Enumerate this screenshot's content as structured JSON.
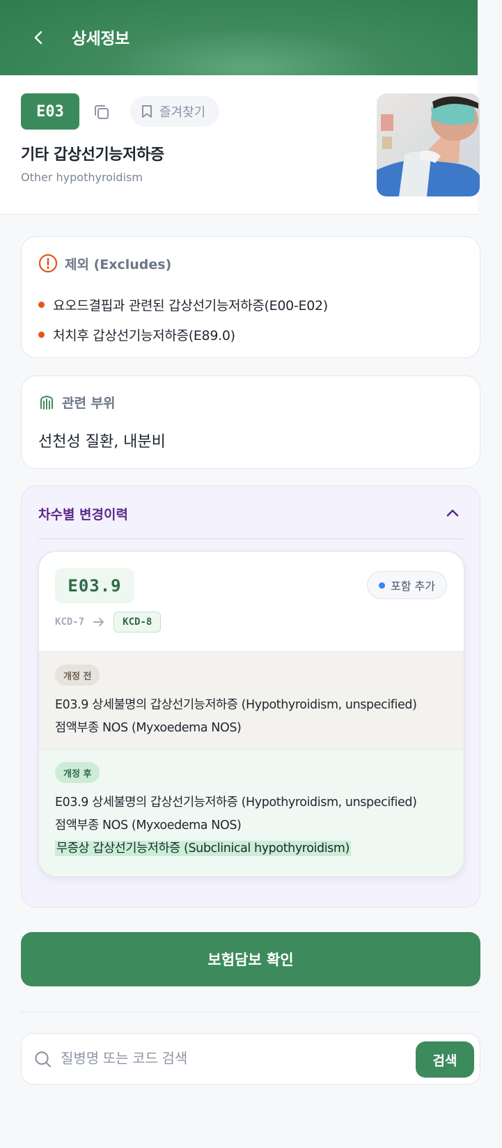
{
  "header": {
    "title": "상세정보",
    "back_icon": "chevron-left-icon"
  },
  "disease": {
    "code": "E03",
    "bookmark_label": "즐겨찾기",
    "name_ko": "기타 갑상선기능저하증",
    "name_en": "Other hypothyroidism"
  },
  "excludes": {
    "title": "제외 (Excludes)",
    "items": [
      "요오드결핍과 관련된 갑상선기능저하증(E00-E02)",
      "처치후 갑상선기능저하증(E89.0)"
    ]
  },
  "region": {
    "title": "관련 부위",
    "value": "선천성 질환, 내분비"
  },
  "history": {
    "title": "차수별 변경이력",
    "entry": {
      "code": "E03.9",
      "change_type": "포함 추가",
      "from_version": "KCD-7",
      "to_version": "KCD-8",
      "before": {
        "tag": "개정 전",
        "lines": [
          "E03.9 상세불명의 갑상선기능저하증 (Hypothyroidism, unspecified)",
          "점액부종 NOS (Myxoedema NOS)"
        ]
      },
      "after": {
        "tag": "개정 후",
        "lines": [
          "E03.9 상세불명의 갑상선기능저하증 (Hypothyroidism, unspecified)",
          "점액부종 NOS (Myxoedema NOS)"
        ],
        "added": "무증상 갑상선기능저하증 (Subclinical hypothyroidism)"
      }
    }
  },
  "insurance_button": "보험담보 확인",
  "search": {
    "placeholder": "질병명 또는 코드 검색",
    "value": "",
    "button": "검색"
  },
  "colors": {
    "primary": "#3d8b5c",
    "warning": "#e5541b",
    "history_title": "#5a2a8a",
    "include_dot": "#3b82f6"
  }
}
